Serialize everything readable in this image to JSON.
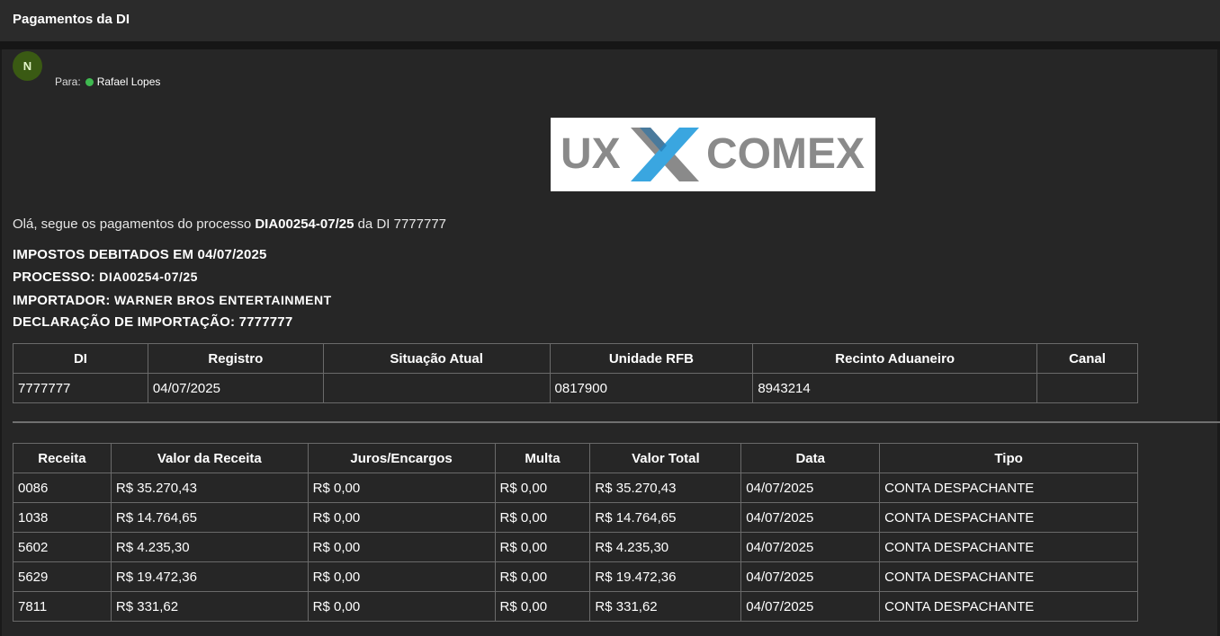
{
  "window": {
    "title": "Pagamentos da DI"
  },
  "message": {
    "avatar_initial": "N",
    "to_label": "Para:",
    "recipient": "Rafael Lopes",
    "logo": {
      "text_left": "UX",
      "text_right": "COMEX",
      "colors": {
        "gray": "#8a8a8a",
        "blue_light": "#3aa6e0",
        "blue_dark": "#1f6fa8"
      }
    },
    "greeting_prefix": "Olá, segue os pagamentos do processo",
    "greeting_process": "DIA00254-07/25",
    "greeting_suffix": "da DI 7777777",
    "info": [
      {
        "label": "IMPOSTOS DEBITADOS EM 04/07/2025",
        "value": ""
      },
      {
        "label": "PROCESSO:",
        "value": "DIA00254-07/25"
      },
      {
        "label": "IMPORTADOR:",
        "value": "WARNER BROS ENTERTAINMENT"
      },
      {
        "label": "DECLARAÇÃO DE IMPORTAÇÃO: 7777777",
        "value": ""
      }
    ]
  },
  "di_table": {
    "headers": [
      "DI",
      "Registro",
      "Situação Atual",
      "Unidade RFB",
      "Recinto Aduaneiro",
      "Canal"
    ],
    "row": [
      "7777777",
      "04/07/2025",
      "",
      "0817900",
      "8943214",
      ""
    ]
  },
  "tx_table": {
    "headers": [
      "Receita",
      "Valor da Receita",
      "Juros/Encargos",
      "Multa",
      "Valor Total",
      "Data",
      "Tipo"
    ],
    "rows": [
      [
        "0086",
        "R$ 35.270,43",
        "R$ 0,00",
        "R$ 0,00",
        "R$ 35.270,43",
        "04/07/2025",
        "CONTA DESPACHANTE"
      ],
      [
        "1038",
        "R$ 14.764,65",
        "R$ 0,00",
        "R$ 0,00",
        "R$ 14.764,65",
        "04/07/2025",
        "CONTA DESPACHANTE"
      ],
      [
        "5602",
        "R$ 4.235,30",
        "R$ 0,00",
        "R$ 0,00",
        "R$ 4.235,30",
        "04/07/2025",
        "CONTA DESPACHANTE"
      ],
      [
        "5629",
        "R$ 19.472,36",
        "R$ 0,00",
        "R$ 0,00",
        "R$ 19.472,36",
        "04/07/2025",
        "CONTA DESPACHANTE"
      ],
      [
        "7811",
        "R$ 331,62",
        "R$ 0,00",
        "R$ 0,00",
        "R$ 331,62",
        "04/07/2025",
        "CONTA DESPACHANTE"
      ]
    ]
  }
}
